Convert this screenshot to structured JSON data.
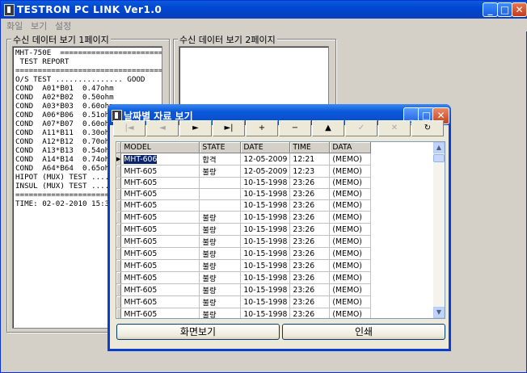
{
  "main": {
    "title": "TESTRON PC LINK Ver1.0",
    "menu": [
      "화일",
      "보기",
      "설정"
    ],
    "group1_label": "수신 데이터 보기 1페이지",
    "group2_label": "수신 데이터 보기 2페이지",
    "report_text": "MHT-750E  ============================\n TEST REPORT\n==================================\nO/S TEST ............... GOOD\nCOND  A01*B01  0.47ohm\nCOND  A02*B02  0.50ohm\nCOND  A03*B03  0.60ohm\nCOND  A06*B06  0.51ohm\nCOND  A07*B07  0.60ohm\nCOND  A11*B11  0.30ohm\nCOND  A12*B12  0.70ohm\nCOND  A13*B13  0.54ohm\nCOND  A14*B14  0.74ohm\nCOND  A64*B64  0.65ohm\nHIPOT (MUX) TEST ........ GOOD\nINSUL (MUX) TEST ........ GOOD\n=================================\nTIME: 02-02-2010 15:38"
  },
  "dialog": {
    "title": "날짜별 자료 보기",
    "nav_buttons": [
      {
        "name": "first-record-button",
        "glyph": "|◄",
        "enabled": false
      },
      {
        "name": "prior-record-button",
        "glyph": "◄",
        "enabled": false
      },
      {
        "name": "next-record-button",
        "glyph": "►",
        "enabled": true
      },
      {
        "name": "last-record-button",
        "glyph": "►|",
        "enabled": true
      },
      {
        "name": "insert-record-button",
        "glyph": "+",
        "enabled": true
      },
      {
        "name": "delete-record-button",
        "glyph": "−",
        "enabled": true
      },
      {
        "name": "edit-record-button",
        "glyph": "▲",
        "enabled": true
      },
      {
        "name": "post-record-button",
        "glyph": "✓",
        "enabled": false
      },
      {
        "name": "cancel-record-button",
        "glyph": "✕",
        "enabled": false
      },
      {
        "name": "refresh-record-button",
        "glyph": "↻",
        "enabled": true
      }
    ],
    "columns": [
      "MODEL",
      "STATE",
      "DATE",
      "TIME",
      "DATA"
    ],
    "rows": [
      [
        "MHT-606",
        "합격",
        "12-05-2009",
        "12:21",
        "(MEMO)"
      ],
      [
        "MHT-605",
        "불량",
        "12-05-2009",
        "12:23",
        "(MEMO)"
      ],
      [
        "MHT-605",
        "",
        "10-15-1998",
        "23:26",
        "(MEMO)"
      ],
      [
        "MHT-605",
        "",
        "10-15-1998",
        "23:26",
        "(MEMO)"
      ],
      [
        "MHT-605",
        "",
        "10-15-1998",
        "23:26",
        "(MEMO)"
      ],
      [
        "MHT-605",
        "불량",
        "10-15-1998",
        "23:26",
        "(MEMO)"
      ],
      [
        "MHT-605",
        "불량",
        "10-15-1998",
        "23:26",
        "(MEMO)"
      ],
      [
        "MHT-605",
        "불량",
        "10-15-1998",
        "23:26",
        "(MEMO)"
      ],
      [
        "MHT-605",
        "불량",
        "10-15-1998",
        "23:26",
        "(MEMO)"
      ],
      [
        "MHT-605",
        "불량",
        "10-15-1998",
        "23:26",
        "(MEMO)"
      ],
      [
        "MHT-605",
        "불량",
        "10-15-1998",
        "23:26",
        "(MEMO)"
      ],
      [
        "MHT-605",
        "불량",
        "10-15-1998",
        "23:26",
        "(MEMO)"
      ],
      [
        "MHT-605",
        "불량",
        "10-15-1998",
        "23:26",
        "(MEMO)"
      ],
      [
        "MHT-605",
        "불량",
        "10-15-1998",
        "23:26",
        "(MEMO)"
      ]
    ],
    "view_button": "화면보기",
    "print_button": "인쇄"
  }
}
